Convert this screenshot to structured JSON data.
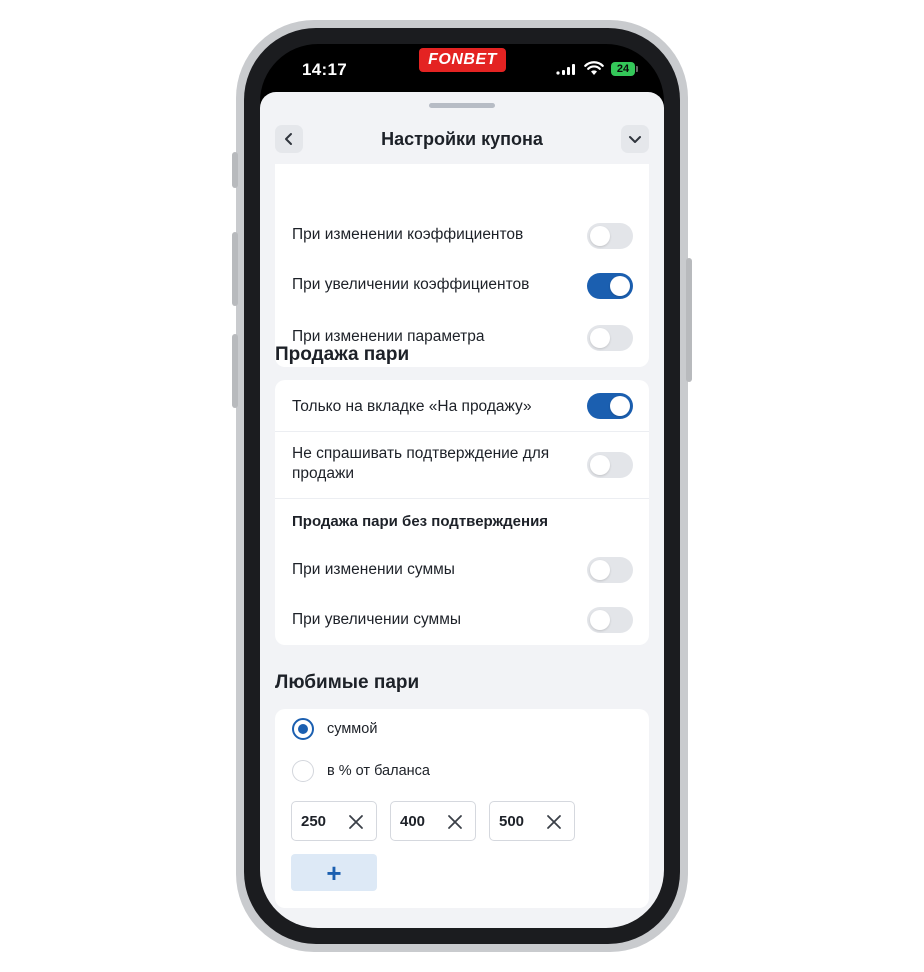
{
  "status_bar": {
    "time": "14:17",
    "brand": "FONBET",
    "battery": "24"
  },
  "header": {
    "title": "Настройки купона",
    "back_icon": "chevron-left-icon",
    "collapse_icon": "chevron-down-icon"
  },
  "odds_section": {
    "items": [
      {
        "label": "При изменении коэффициентов",
        "on": false
      },
      {
        "label": "При увеличении коэффициентов",
        "on": true
      },
      {
        "label": "При изменении параметра",
        "on": false
      }
    ]
  },
  "sale_section": {
    "title": "Продажа пари",
    "only_tab": {
      "label": "Только на вкладке «На продажу»",
      "on": true
    },
    "no_confirm": {
      "label": "Не спрашивать подтверждение для продажи",
      "on": false
    },
    "subheading": "Продажа пари без подтверждения",
    "amount_change": {
      "label": "При изменении суммы",
      "on": false
    },
    "amount_increase": {
      "label": "При увеличении суммы",
      "on": false
    }
  },
  "favorite_section": {
    "title": "Любимые пари",
    "options": [
      {
        "label": "суммой",
        "selected": true
      },
      {
        "label": "в % от баланса",
        "selected": false
      }
    ],
    "amounts": [
      "250",
      "400",
      "500"
    ],
    "add_label": "+"
  },
  "colors": {
    "accent": "#1b5fb0",
    "brand": "#e42322",
    "toggle_off": "#e3e5e9",
    "background": "#f2f3f6"
  }
}
